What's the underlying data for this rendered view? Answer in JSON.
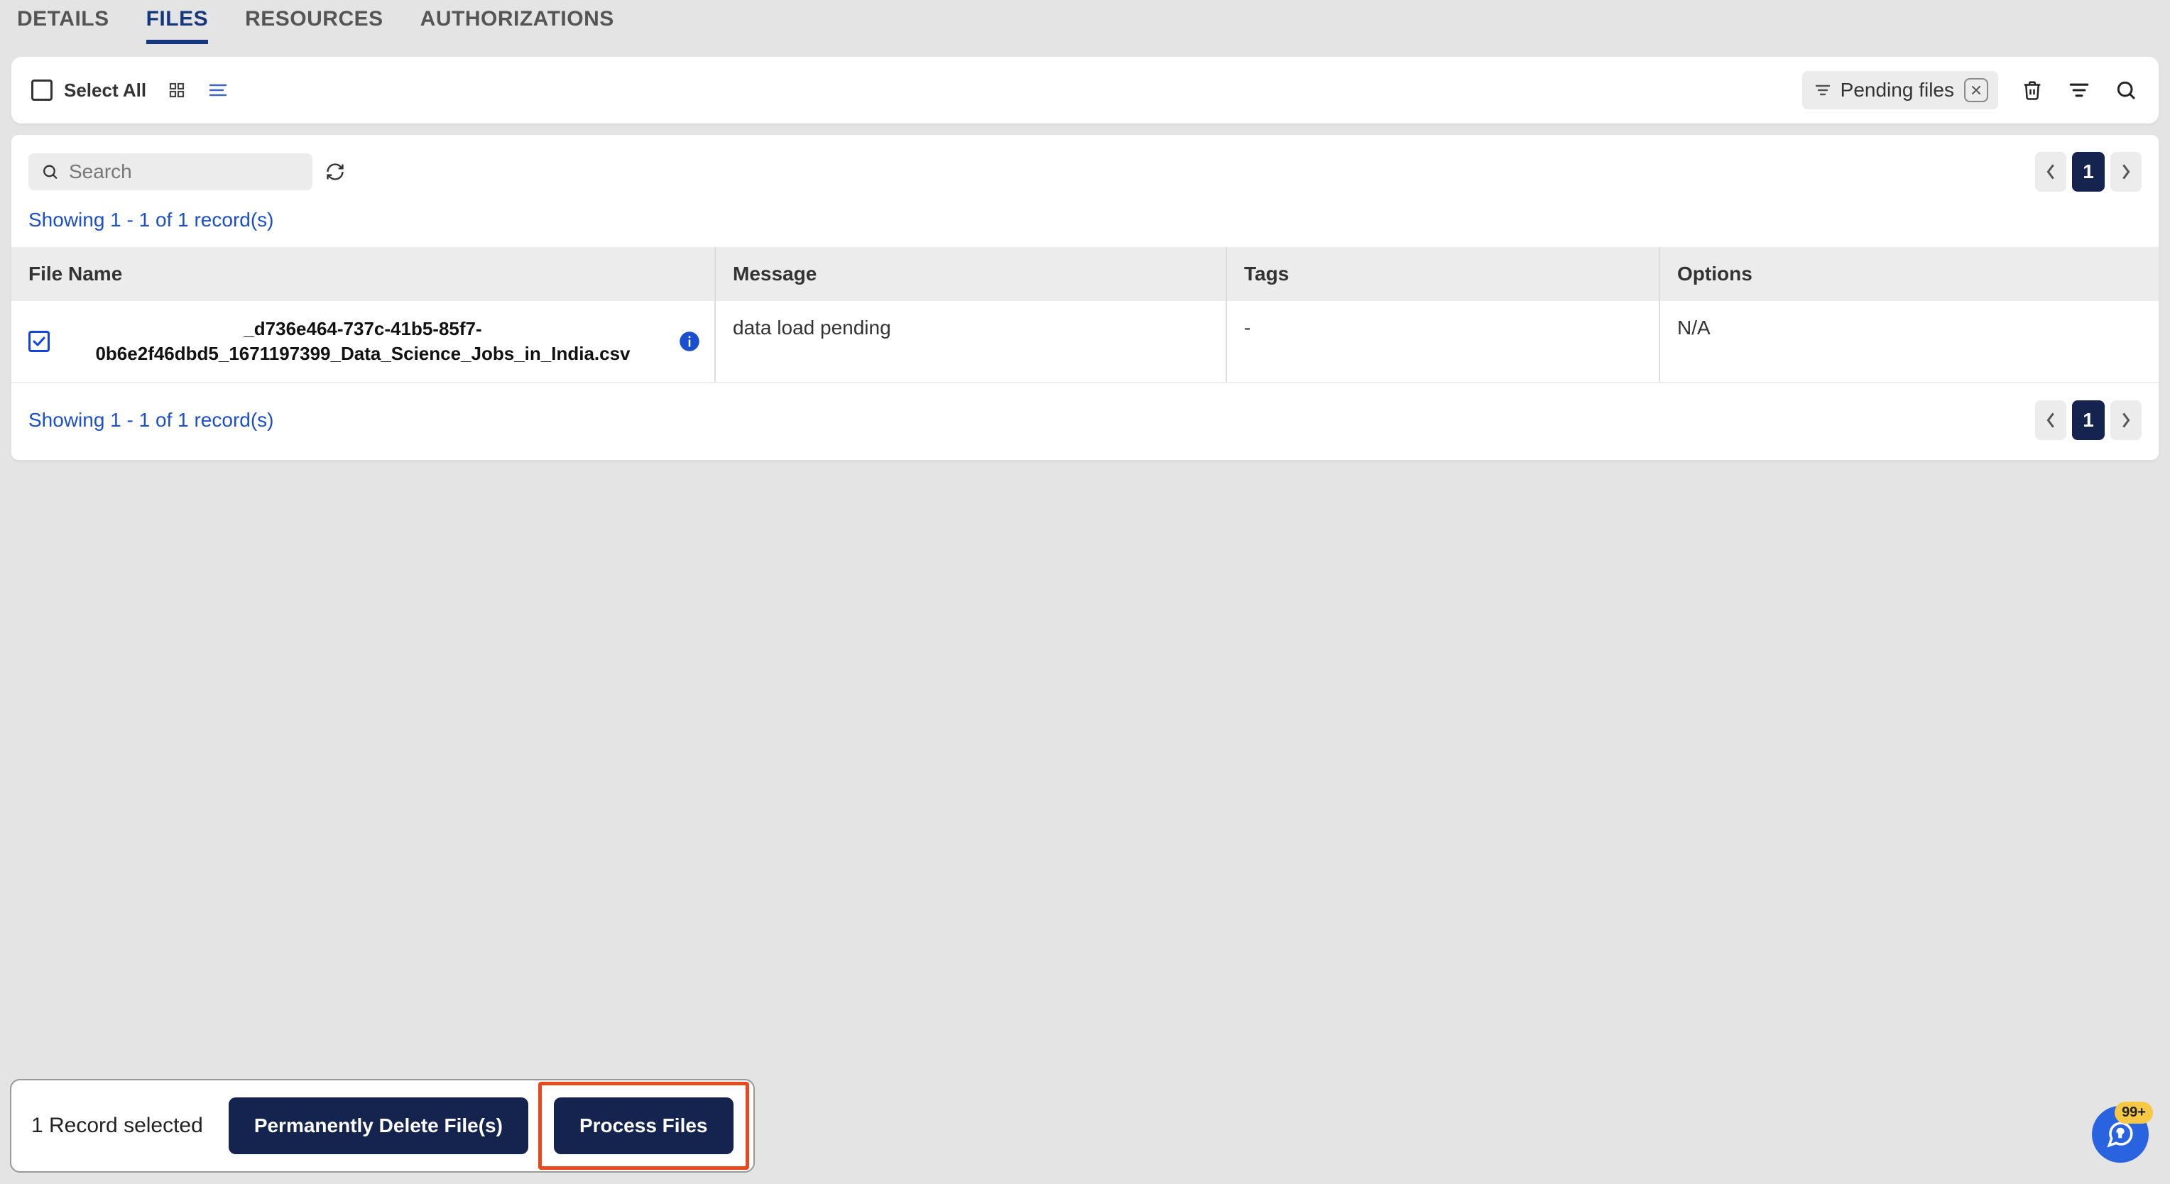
{
  "tabs": {
    "details": "DETAILS",
    "files": "FILES",
    "resources": "RESOURCES",
    "authorizations": "AUTHORIZATIONS",
    "active": "files"
  },
  "toolbar": {
    "select_all": "Select All",
    "chip_label": "Pending files"
  },
  "search": {
    "placeholder": "Search"
  },
  "pagination": {
    "page": "1",
    "showing": "Showing 1 - 1 of 1 record(s)"
  },
  "table": {
    "headers": {
      "file_name": "File Name",
      "message": "Message",
      "tags": "Tags",
      "options": "Options"
    },
    "rows": [
      {
        "checked": true,
        "file_name": "_d736e464-737c-41b5-85f7-0b6e2f46dbd5_1671197399_Data_Science_Jobs_in_India.csv",
        "message": "data load pending",
        "tags": "-",
        "options": "N/A"
      }
    ]
  },
  "footer": {
    "selected": "1 Record selected",
    "delete": "Permanently Delete File(s)",
    "process": "Process Files"
  },
  "chat": {
    "badge": "99+"
  }
}
